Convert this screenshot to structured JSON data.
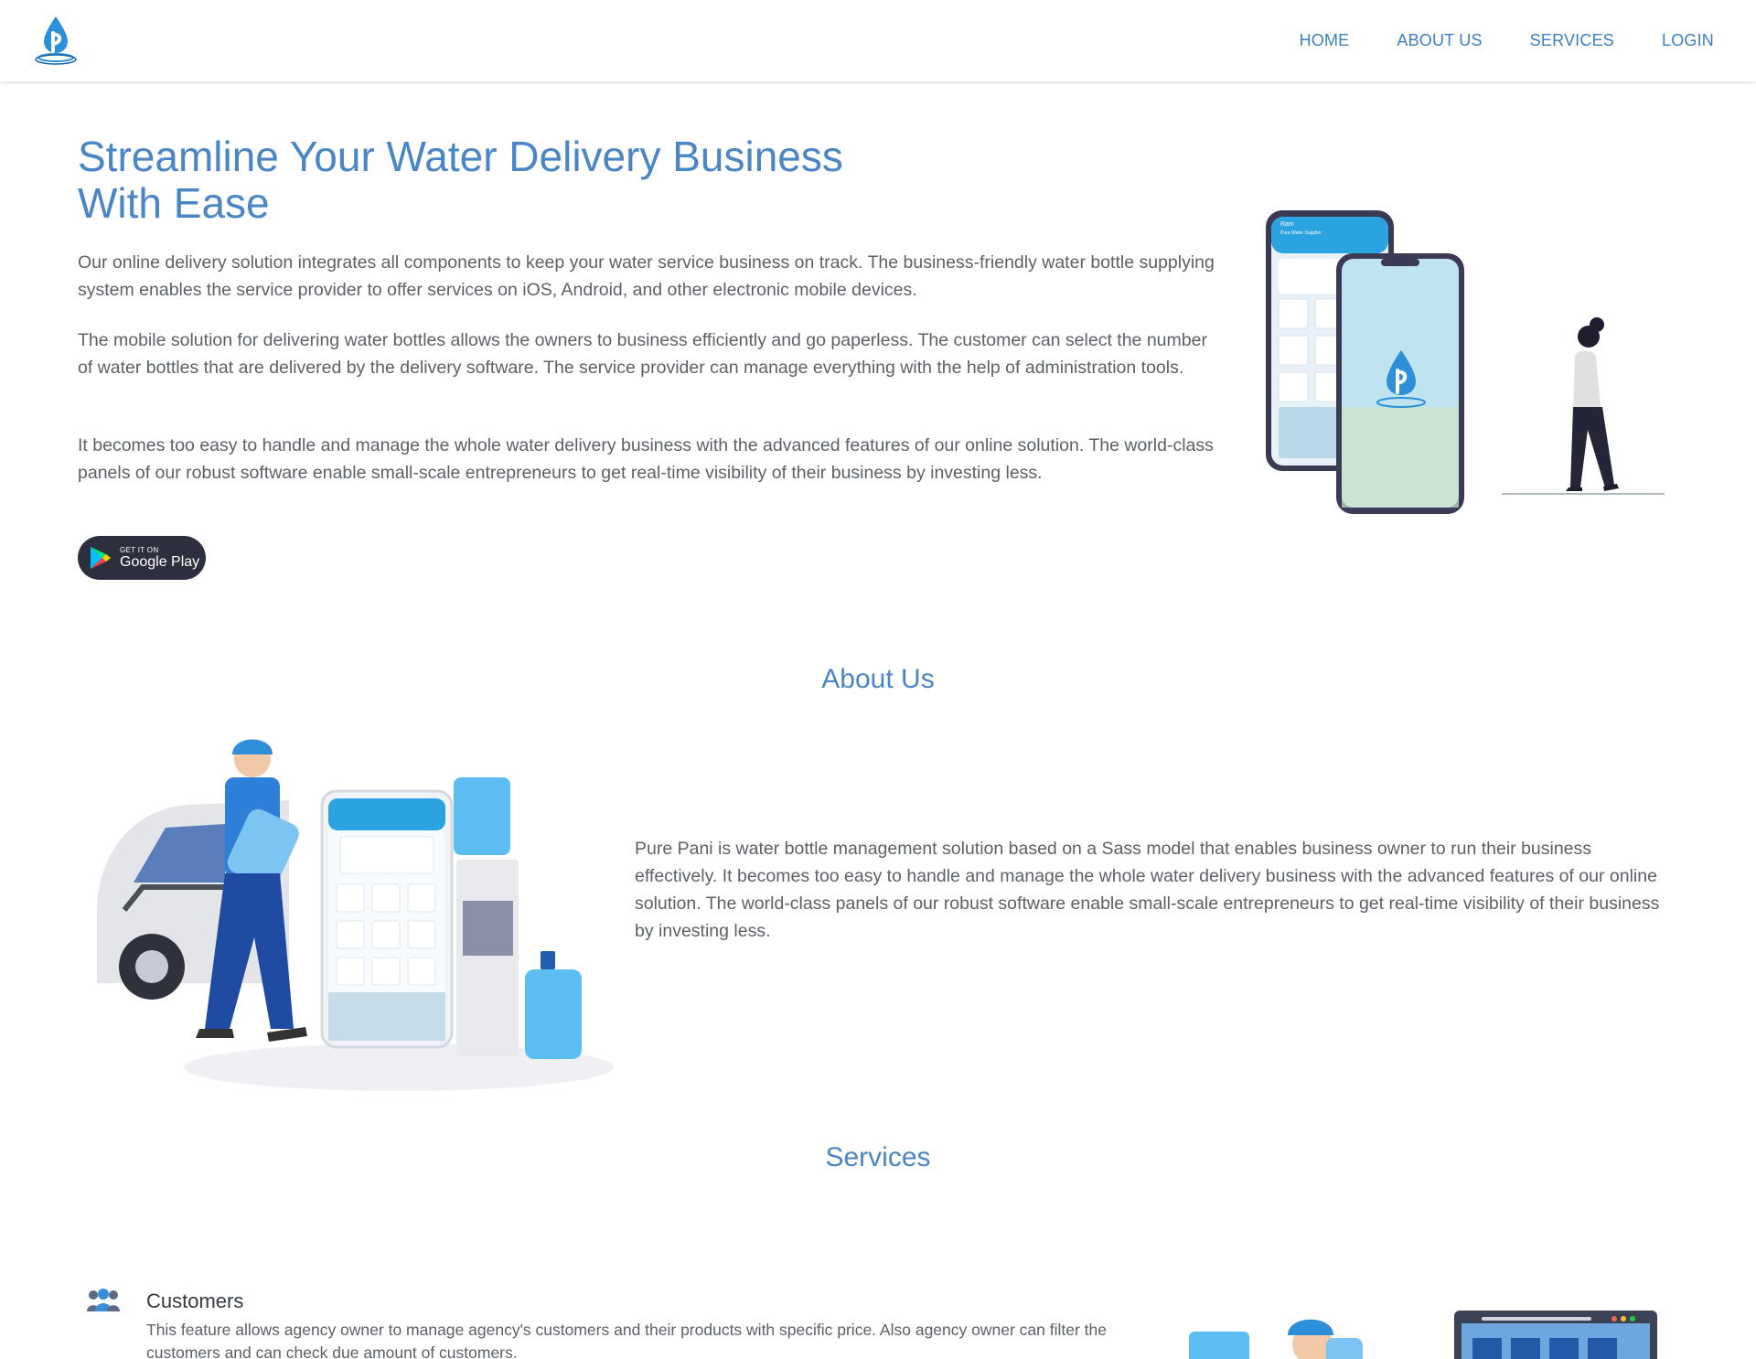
{
  "header": {
    "nav": [
      {
        "label": "HOME"
      },
      {
        "label": "ABOUT US"
      },
      {
        "label": "SERVICES"
      },
      {
        "label": "LOGIN"
      }
    ]
  },
  "hero": {
    "title_line1": "Streamline Your Water Delivery Business",
    "title_line2": "With Ease",
    "paragraphs": [
      "Our online delivery solution integrates all components to keep your water service business on track. The business-friendly water bottle supplying system enables the service provider to offer services on iOS, Android, and other electronic mobile devices.",
      "The mobile solution for delivering water bottles allows the owners to business efficiently and go paperless. The customer can select the number of water bottles that are delivered by the delivery software. The service provider can manage everything with the help of administration tools.",
      "It becomes too easy to handle and manage the whole water delivery business with the advanced features of our online solution. The world-class panels of our robust software enable small-scale entrepreneurs to get real-time visibility of their business by investing less."
    ],
    "store_badge": {
      "small": "GET IT ON",
      "big": "Google Play"
    },
    "phone_screen": {
      "name": "Ram",
      "subtitle": "Pure Water Supplier"
    }
  },
  "about": {
    "title": "About Us",
    "text": "Pure Pani is water bottle management solution based on a Sass model that enables business owner to run their business effectively. It becomes too easy to handle and manage the whole water delivery business with the advanced features of our online solution. The world-class panels of our robust software enable small-scale entrepreneurs to get real-time visibility of their business by investing less."
  },
  "services": {
    "title": "Services",
    "items": [
      {
        "title": "Customers",
        "description": "This feature allows agency owner to manage agency's customers and their products with specific price. Also agency owner can filter the customers and can check due amount of customers."
      }
    ]
  },
  "colors": {
    "brand_blue": "#4a86c5",
    "nav_blue": "#3b7fc4",
    "badge_dark": "#2d2f3f",
    "text_gray": "#5c6168"
  },
  "icons": [
    "water-drop-logo-icon",
    "google-play-icon",
    "customers-icon"
  ]
}
